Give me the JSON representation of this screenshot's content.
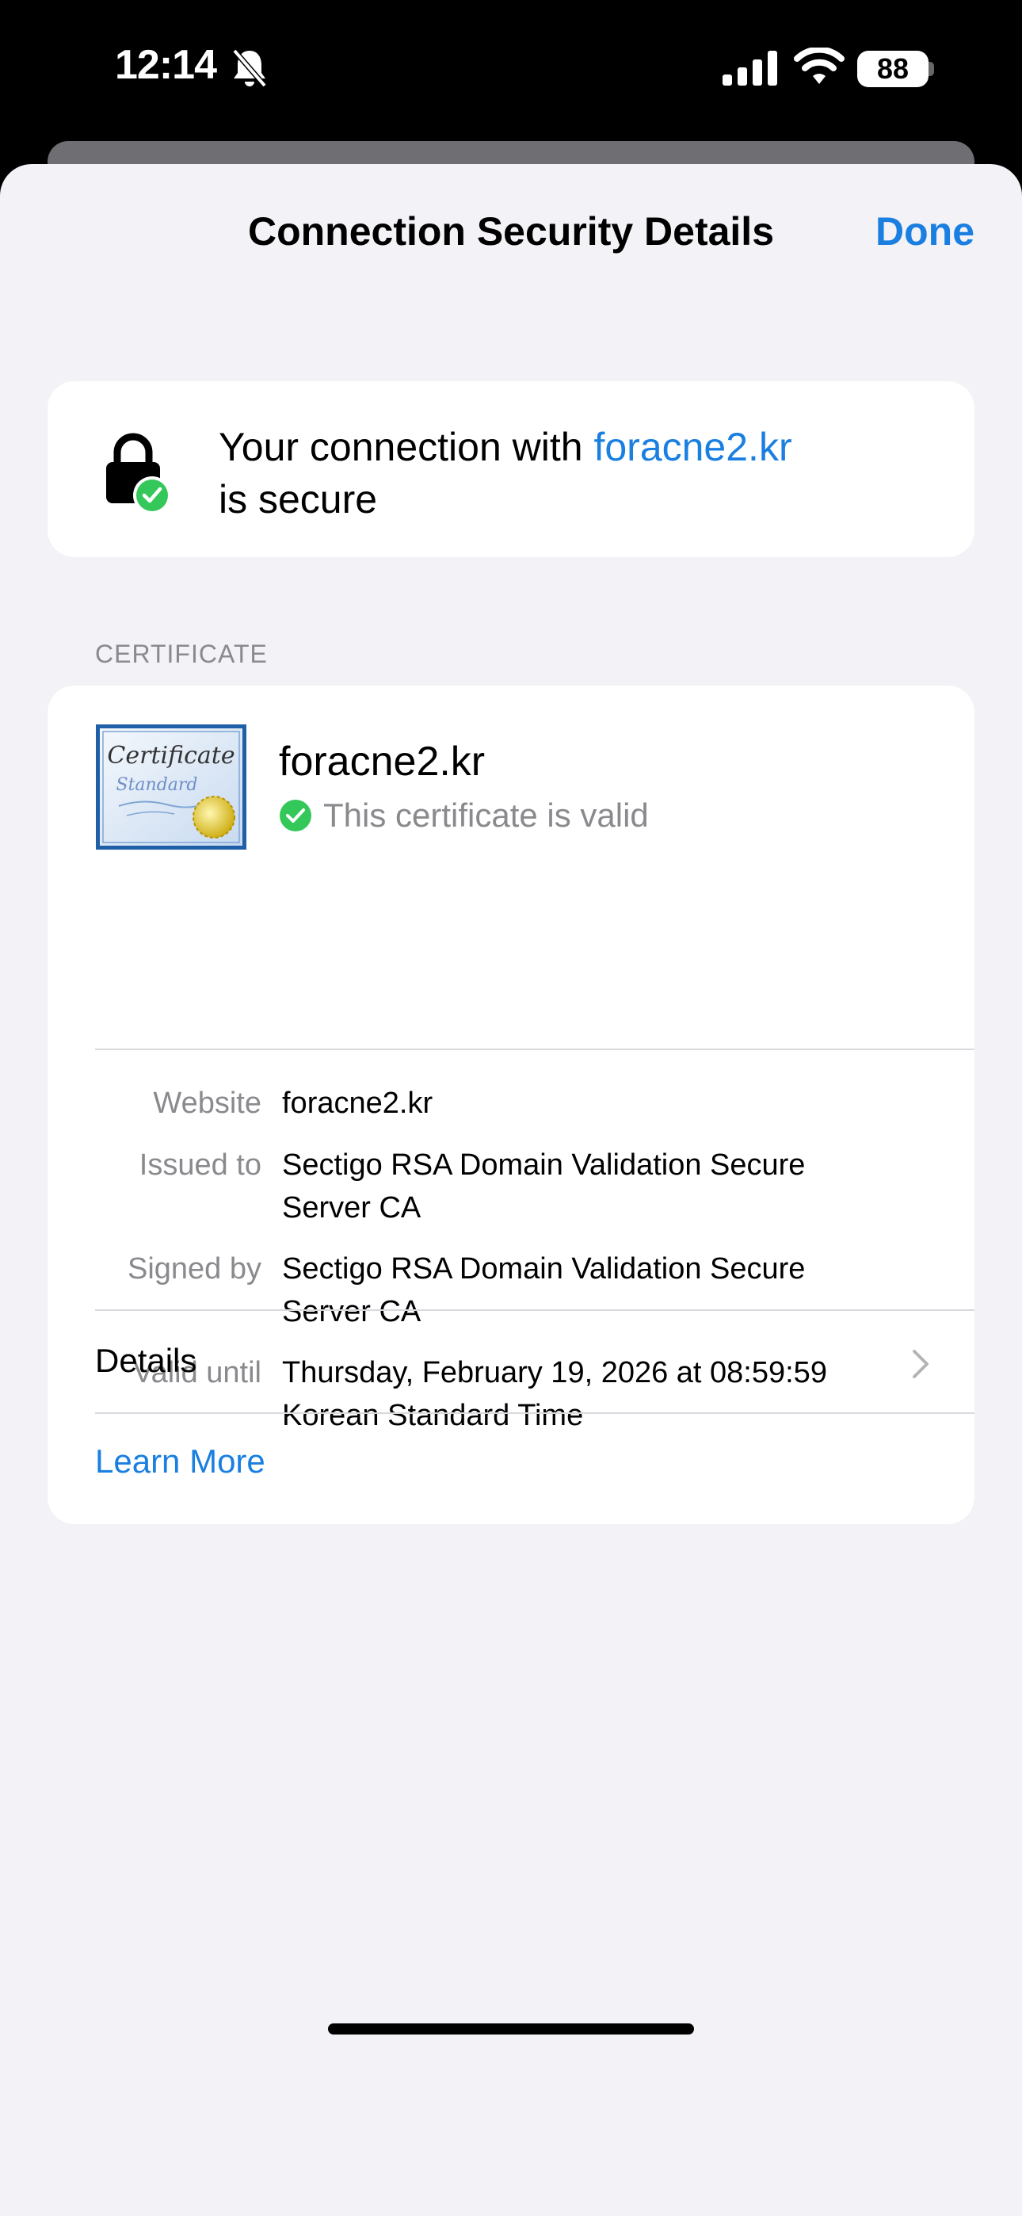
{
  "status_bar": {
    "time": "12:14",
    "battery": "88",
    "icons": [
      "bell-slash-icon",
      "cellular-signal-icon",
      "wifi-icon",
      "battery-icon"
    ]
  },
  "nav": {
    "title": "Connection Security Details",
    "done_label": "Done"
  },
  "connection": {
    "text_before": "Your connection with ",
    "domain": "foracne2.kr",
    "text_after": "is secure",
    "icon": "lock-icon"
  },
  "certificate": {
    "section_label": "CERTIFICATE",
    "domain": "foracne2.kr",
    "status": "This certificate is valid",
    "image_text": {
      "line1": "Certificate",
      "line2": "Standard"
    },
    "fields": [
      {
        "label": "Website",
        "value": "foracne2.kr"
      },
      {
        "label": "Issued to",
        "value": "Sectigo RSA Domain Validation Secure",
        "value2": "Server CA"
      },
      {
        "label": "Signed by",
        "value": "Sectigo RSA Domain Validation Secure",
        "value2": "Server CA"
      },
      {
        "label": "Valid until",
        "value": "Thursday, February 19, 2026 at 08:59:59",
        "value2": "Korean Standard Time"
      }
    ],
    "details_label": "Details",
    "learn_more_label": "Learn More"
  },
  "colors": {
    "accent": "#1a7fe0",
    "success": "#34c759",
    "sheet_background": "#f2f2f7",
    "secondary_text": "#8a8a8e"
  }
}
